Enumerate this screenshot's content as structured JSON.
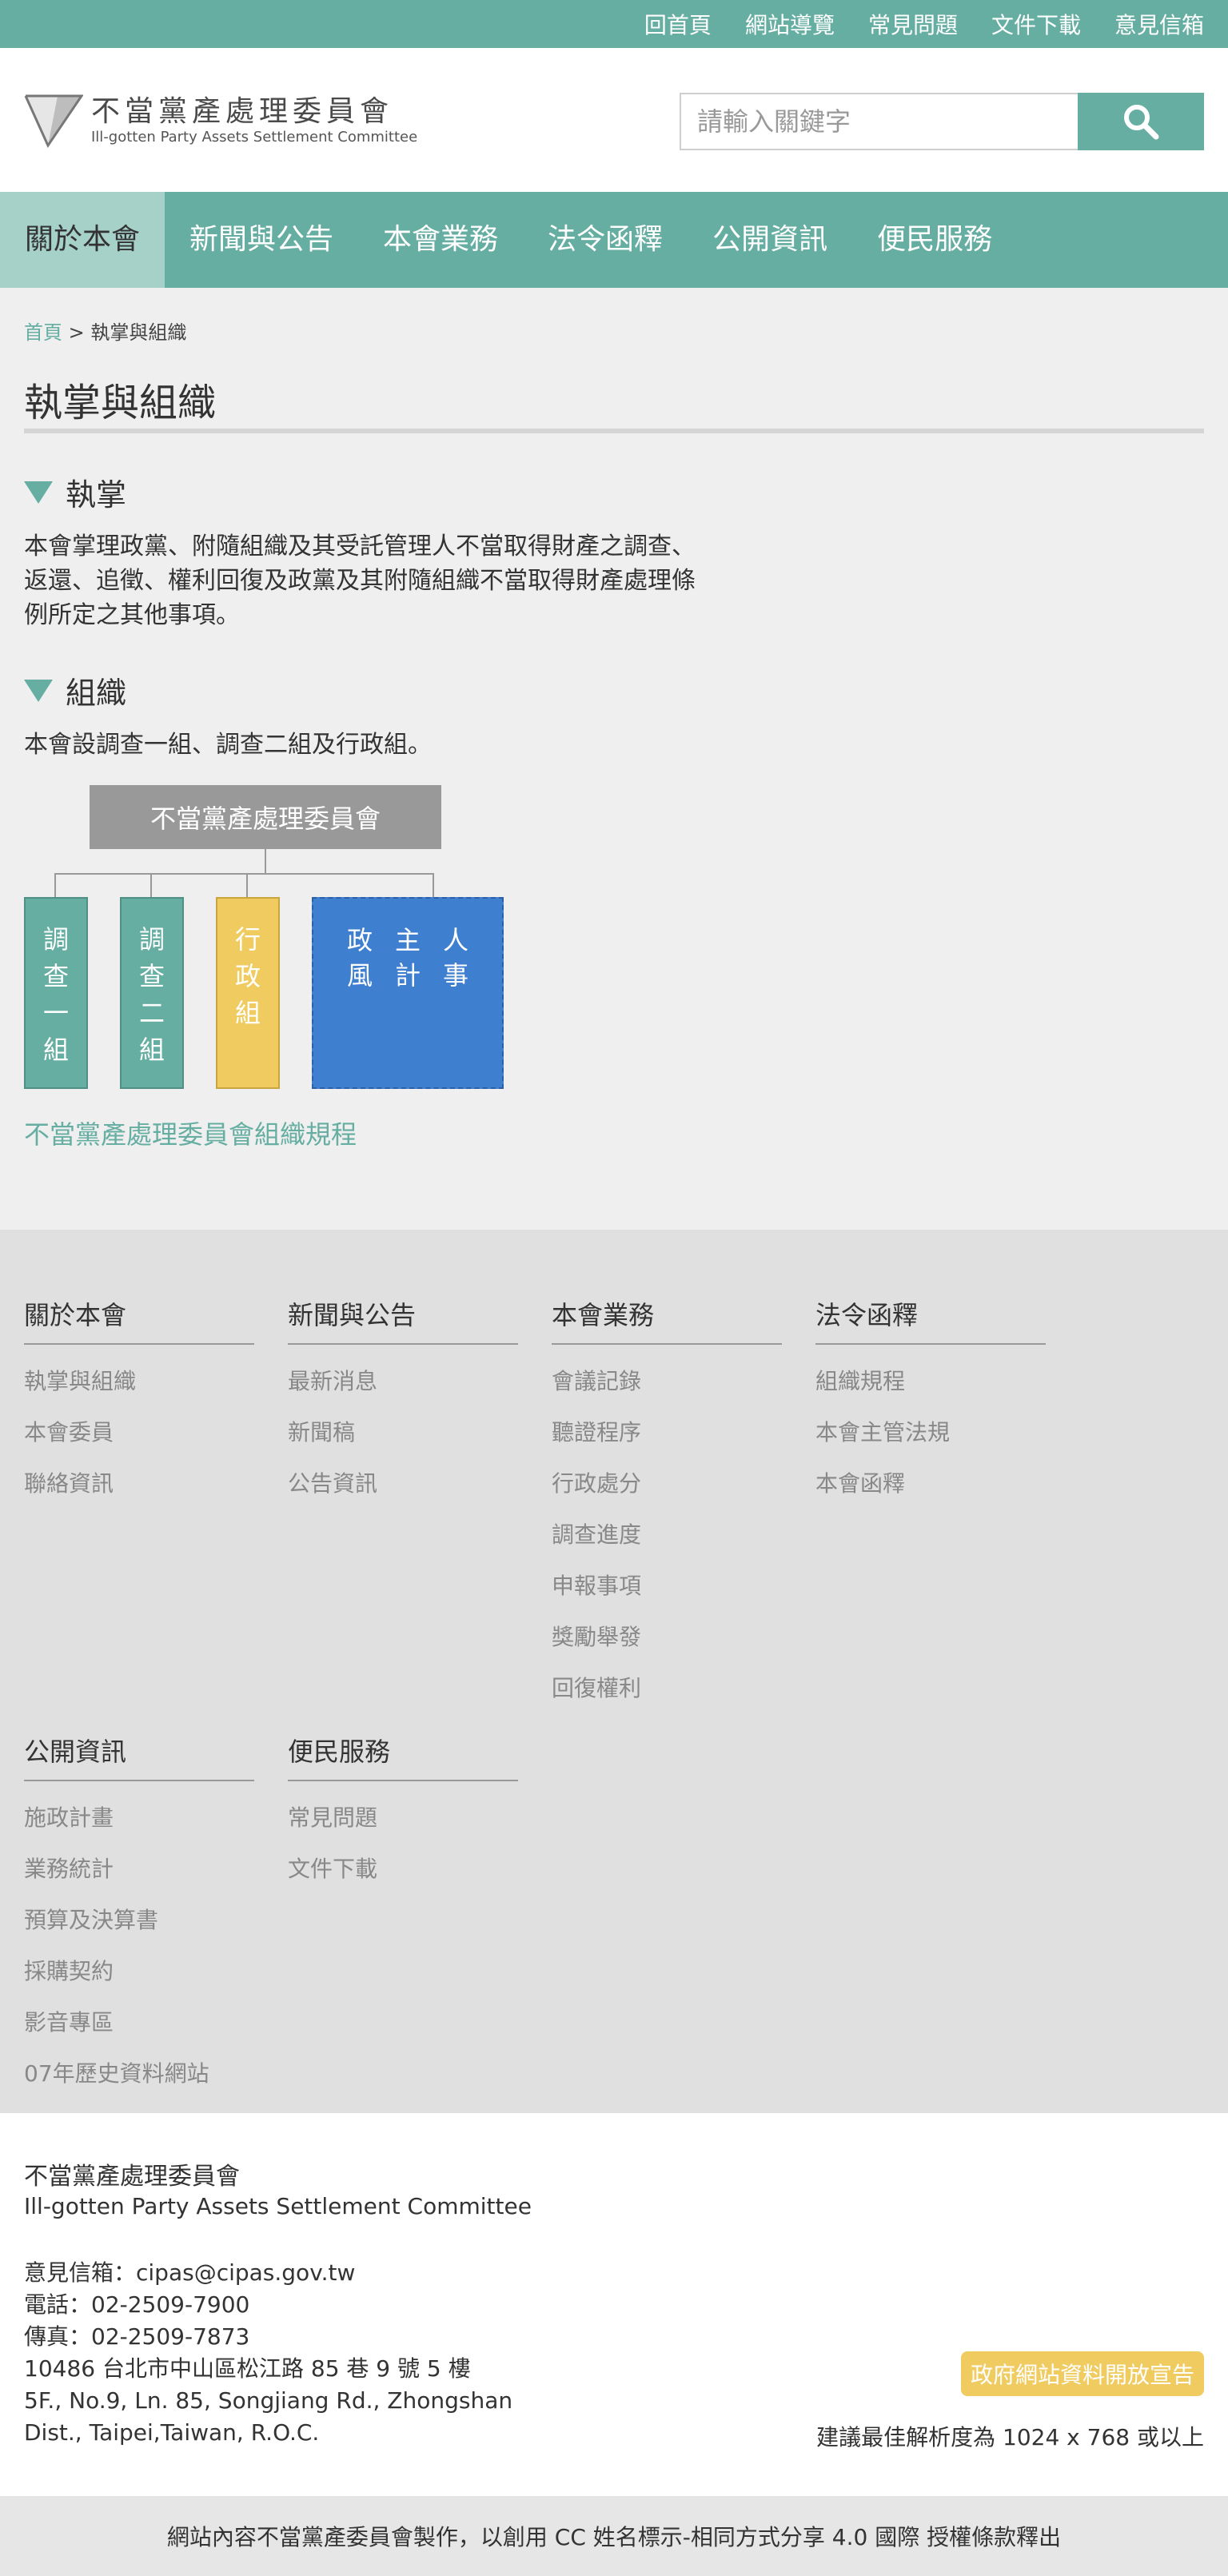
{
  "topbar": {
    "links": [
      "回首頁",
      "網站導覽",
      "常見問題",
      "文件下載",
      "意見信箱"
    ]
  },
  "header": {
    "logo_zh": "不當黨產處理委員會",
    "logo_en": "Ill-gotten Party Assets Settlement Committee",
    "search_placeholder": "請輸入關鍵字",
    "search_icon": "search-icon"
  },
  "nav": {
    "items": [
      "關於本會",
      "新聞與公告",
      "本會業務",
      "法令函釋",
      "公開資訊",
      "便民服務"
    ],
    "active": "關於本會"
  },
  "breadcrumb": {
    "home": "首頁",
    "sep": " > ",
    "current": "執掌與組織"
  },
  "main": {
    "title": "執掌與組織",
    "section1": {
      "heading": "執掌",
      "lines": [
        "本會掌理政黨、附隨組織及其受託管理人不當取得財產之調查、",
        "返還、追徵、權利回復及政黨及其附隨組織不當取得財產處理條",
        "例所定之其他事項。"
      ]
    },
    "section2": {
      "heading": "組織",
      "text": "本會設調查一組、調查二組及行政組。"
    },
    "org_chart": {
      "top": "不當黨產處理委員會",
      "units": [
        {
          "chars": [
            "調",
            "查",
            "一",
            "組"
          ]
        },
        {
          "chars": [
            "調",
            "查",
            "二",
            "組"
          ]
        },
        {
          "chars": [
            "行",
            "政",
            "組"
          ]
        }
      ],
      "offices": [
        [
          "政",
          "風"
        ],
        [
          "主",
          "計"
        ],
        [
          "人",
          "事"
        ]
      ]
    },
    "org_link": "不當黨產處理委員會組織規程"
  },
  "sitemap": {
    "columns": [
      {
        "title": "關於本會",
        "items": [
          "執掌與組織",
          "本會委員",
          "聯絡資訊"
        ]
      },
      {
        "title": "新聞與公告",
        "items": [
          "最新消息",
          "新聞稿",
          "公告資訊"
        ]
      },
      {
        "title": "本會業務",
        "items": [
          "會議記錄",
          "聽證程序",
          "行政處分",
          "調查進度",
          "申報事項",
          "獎勵舉發",
          "回復權利"
        ]
      },
      {
        "title": "法令函釋",
        "items": [
          "組織規程",
          "本會主管法規",
          "本會函釋"
        ]
      },
      {
        "title": "公開資訊",
        "items": [
          "施政計畫",
          "業務統計",
          "預算及決算書",
          "採購契約",
          "影音專區",
          "07年歷史資料網站"
        ]
      },
      {
        "title": "便民服務",
        "items": [
          "常見問題",
          "文件下載"
        ]
      }
    ]
  },
  "info": {
    "name_zh": "不當黨產處理委員會",
    "name_en": "Ill-gotten Party Assets Settlement Committee",
    "lines": [
      "意見信箱：cipas@cipas.gov.tw",
      "電話：02-2509-7900",
      "傳真：02-2509-7873",
      "10486 台北市中山區松江路 85 巷 9 號 5 樓",
      "5F., No.9, Ln. 85, Songjiang Rd., Zhongshan",
      "Dist., Taipei,Taiwan, R.O.C."
    ],
    "badge": "政府網站資料開放宣告",
    "resolution": "建議最佳解析度為 1024 x 768 或以上"
  },
  "license": "網站內容不當黨產委員會製作，以創用 CC 姓名標示-相同方式分享 4.0 國際 授權條款釋出",
  "colors": {
    "primary": "#66aea2",
    "nav_active": "#a6d1c8",
    "yellow": "#f0cc60",
    "blue": "#3f7fd0"
  }
}
